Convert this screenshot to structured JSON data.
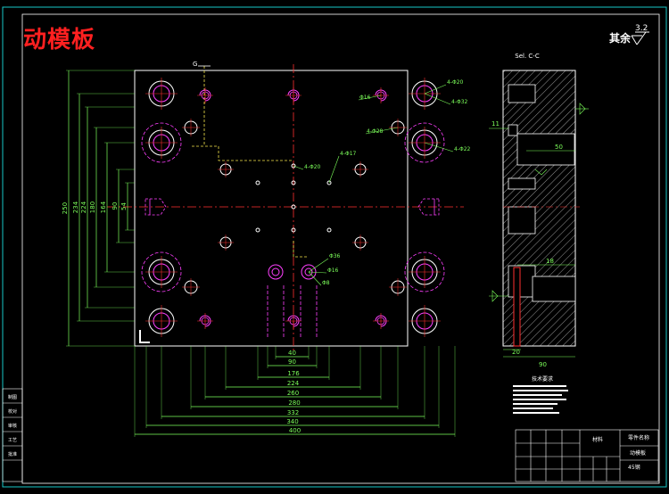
{
  "drawing": {
    "title": "动模板",
    "roughness_prefix": "其余",
    "roughness_value": "3.2",
    "section_label": "Sel. C-C"
  },
  "front_view": {
    "height_dims": [
      "250",
      "234",
      "224",
      "180",
      "164",
      "90",
      "54"
    ],
    "bottom_dims": [
      "40",
      "90",
      "176",
      "224",
      "260",
      "280",
      "332",
      "340",
      "400"
    ],
    "leaders": [
      "4-Φ20",
      "4-Φ32",
      "Φ16",
      "4-Φ28",
      "4-Φ17",
      "4-Φ20",
      "4-Φ22",
      "Φ36",
      "Φ16",
      "Φ8"
    ],
    "corner_mark": "G"
  },
  "section_view": {
    "dims": [
      "11",
      "50",
      "18",
      "20",
      "90"
    ]
  },
  "notes": {
    "heading": "技术要求"
  },
  "title_block": {
    "part_label": "零件名称",
    "part_name": "动模板",
    "material_label": "材料",
    "material": "45钢"
  },
  "side_panel": {
    "labels": [
      "制图",
      "校对",
      "审核",
      "工艺",
      "批准"
    ]
  },
  "colors": {
    "background": "#000000",
    "outline": "#ffffff",
    "dimension": "#7cff5a",
    "centerline": "#ff3030",
    "hole_magenta": "#ff40ff",
    "title": "#ff2020",
    "frame": "#19c8c8",
    "leader_yellow": "#f5e64a",
    "text_red": "#ff4040"
  }
}
